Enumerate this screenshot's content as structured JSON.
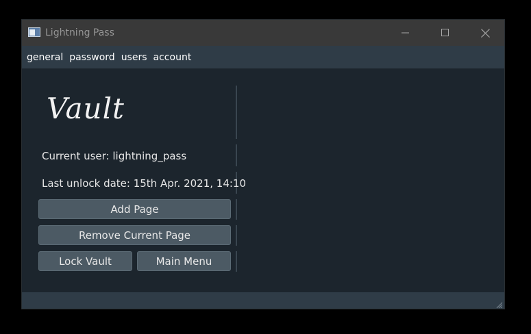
{
  "window": {
    "title": "Lightning Pass"
  },
  "menubar": {
    "items": [
      "general",
      "password",
      "users",
      "account"
    ]
  },
  "vault": {
    "heading": "Vault",
    "current_user": "Current user: lightning_pass",
    "last_unlock": "Last unlock date: 15th Apr. 2021, 14:10"
  },
  "actions": {
    "add_page": "Add Page",
    "remove_page": "Remove Current Page",
    "lock_vault": "Lock Vault",
    "main_menu": "Main Menu"
  },
  "icons": {
    "app": "app-window-icon",
    "minimize": "minimize-icon",
    "maximize": "maximize-icon",
    "close": "close-icon",
    "resize": "resize-grip-icon"
  },
  "colors": {
    "background": "#1c252d",
    "menubar": "#2f3c47",
    "button": "#4c5a64",
    "titlebar": "#393939"
  }
}
